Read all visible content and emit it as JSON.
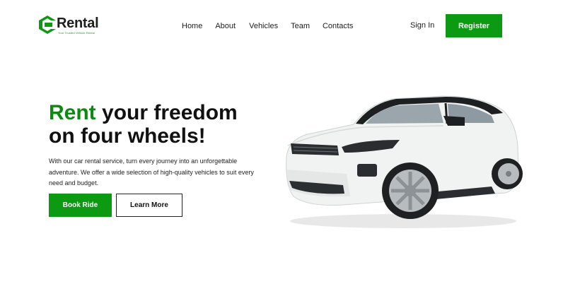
{
  "brand": {
    "name": "Rental",
    "tagline": "Your Trusted Vehicle Rental",
    "color": "#0c9a12"
  },
  "nav": {
    "items": [
      "Home",
      "About",
      "Vehicles",
      "Team",
      "Contacts"
    ]
  },
  "auth": {
    "signin_label": "Sign In",
    "register_label": "Register"
  },
  "hero": {
    "title_accent": "Rent",
    "title_rest_line1": " your freedom",
    "title_line2": "on four wheels!",
    "description": "With our car rental service, turn every journey into an unforgettable adventure. We offer a wide selection of high-quality vehicles to suit every need and budget.",
    "primary_button": "Book Ride",
    "secondary_button": "Learn More",
    "image": "white-suv-car"
  }
}
